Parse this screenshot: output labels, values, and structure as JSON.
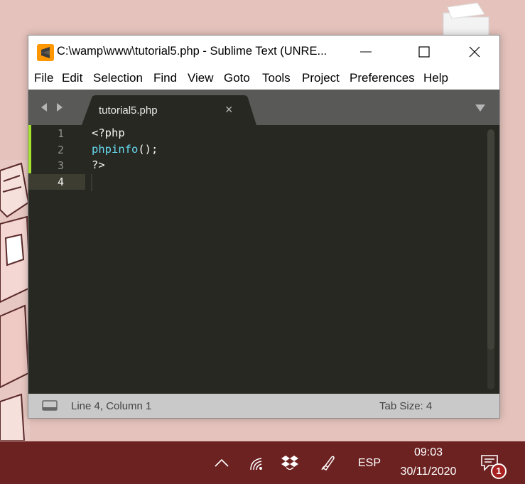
{
  "window": {
    "title": "C:\\wamp\\www\\tutorial5.php - Sublime Text (UNRE..."
  },
  "menu": [
    "File",
    "Edit",
    "Selection",
    "Find",
    "View",
    "Goto",
    "Tools",
    "Project",
    "Preferences",
    "Help"
  ],
  "tab": {
    "label": "tutorial5.php",
    "close": "×"
  },
  "editor": {
    "line_numbers": [
      "1",
      "2",
      "3",
      "4"
    ],
    "lines": [
      {
        "text": "<?php"
      },
      {
        "fn": "phpinfo",
        "rest": "();"
      },
      {
        "text": "?>"
      },
      {
        "text": ""
      }
    ],
    "active_line": 4,
    "colors": {
      "background": "#272822",
      "function": "#66d9ef",
      "text": "#f8f8f2",
      "modified_gutter": "#a6e22e"
    }
  },
  "status": {
    "position": "Line 4, Column 1",
    "tab_size": "Tab Size: 4"
  },
  "taskbar": {
    "icons": [
      "chevron-up-icon",
      "wifi-icon",
      "dropbox-icon",
      "pen-icon"
    ],
    "language": "ESP",
    "time": "09:03",
    "date": "30/11/2020",
    "notifications": "1",
    "background": "#6d2222"
  }
}
